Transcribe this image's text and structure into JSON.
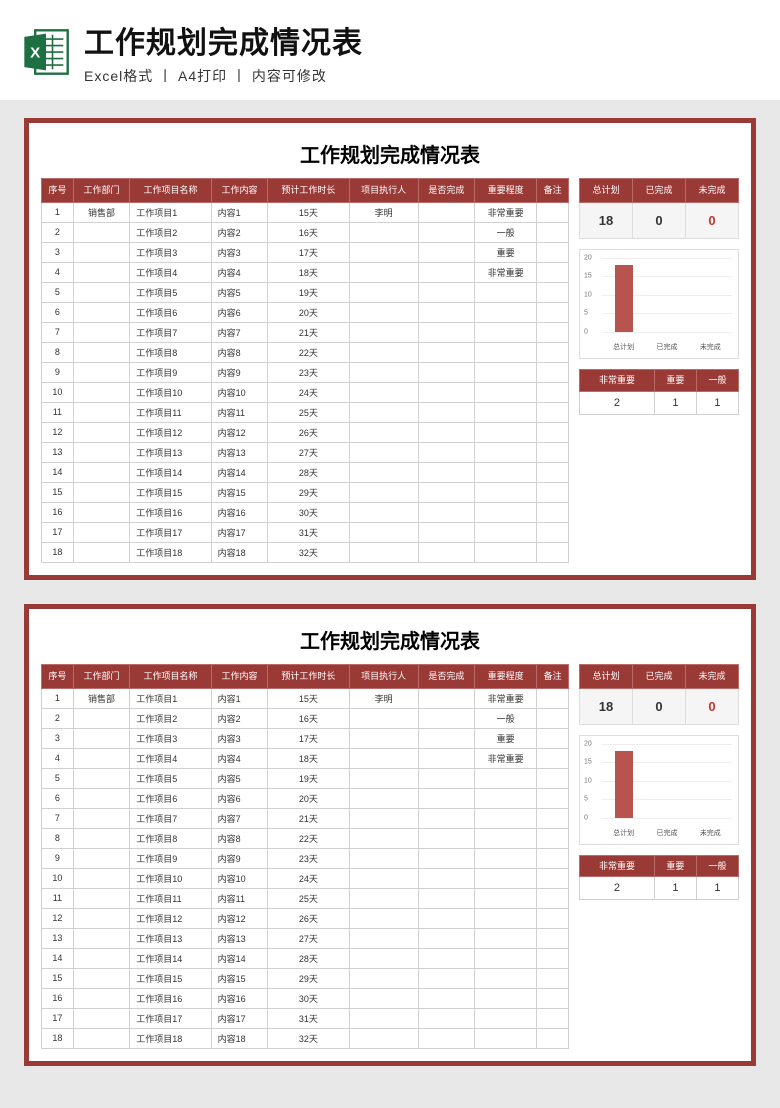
{
  "header": {
    "title": "工作规划完成情况表",
    "subtitle": "Excel格式 丨 A4打印 丨 内容可修改"
  },
  "sheet": {
    "title": "工作规划完成情况表",
    "columns": [
      "序号",
      "工作部门",
      "工作项目名称",
      "工作内容",
      "预计工作时长",
      "项目执行人",
      "是否完成",
      "重要程度",
      "备注"
    ],
    "rows": [
      {
        "no": "1",
        "dept": "销售部",
        "proj": "工作项目1",
        "content": "内容1",
        "dur": "15天",
        "exec": "李明",
        "done": "",
        "priority": "非常重要",
        "note": ""
      },
      {
        "no": "2",
        "dept": "",
        "proj": "工作项目2",
        "content": "内容2",
        "dur": "16天",
        "exec": "",
        "done": "",
        "priority": "一般",
        "note": ""
      },
      {
        "no": "3",
        "dept": "",
        "proj": "工作项目3",
        "content": "内容3",
        "dur": "17天",
        "exec": "",
        "done": "",
        "priority": "重要",
        "note": ""
      },
      {
        "no": "4",
        "dept": "",
        "proj": "工作项目4",
        "content": "内容4",
        "dur": "18天",
        "exec": "",
        "done": "",
        "priority": "非常重要",
        "note": ""
      },
      {
        "no": "5",
        "dept": "",
        "proj": "工作项目5",
        "content": "内容5",
        "dur": "19天",
        "exec": "",
        "done": "",
        "priority": "",
        "note": ""
      },
      {
        "no": "6",
        "dept": "",
        "proj": "工作项目6",
        "content": "内容6",
        "dur": "20天",
        "exec": "",
        "done": "",
        "priority": "",
        "note": ""
      },
      {
        "no": "7",
        "dept": "",
        "proj": "工作项目7",
        "content": "内容7",
        "dur": "21天",
        "exec": "",
        "done": "",
        "priority": "",
        "note": ""
      },
      {
        "no": "8",
        "dept": "",
        "proj": "工作项目8",
        "content": "内容8",
        "dur": "22天",
        "exec": "",
        "done": "",
        "priority": "",
        "note": ""
      },
      {
        "no": "9",
        "dept": "",
        "proj": "工作项目9",
        "content": "内容9",
        "dur": "23天",
        "exec": "",
        "done": "",
        "priority": "",
        "note": ""
      },
      {
        "no": "10",
        "dept": "",
        "proj": "工作项目10",
        "content": "内容10",
        "dur": "24天",
        "exec": "",
        "done": "",
        "priority": "",
        "note": ""
      },
      {
        "no": "11",
        "dept": "",
        "proj": "工作项目11",
        "content": "内容11",
        "dur": "25天",
        "exec": "",
        "done": "",
        "priority": "",
        "note": ""
      },
      {
        "no": "12",
        "dept": "",
        "proj": "工作项目12",
        "content": "内容12",
        "dur": "26天",
        "exec": "",
        "done": "",
        "priority": "",
        "note": ""
      },
      {
        "no": "13",
        "dept": "",
        "proj": "工作项目13",
        "content": "内容13",
        "dur": "27天",
        "exec": "",
        "done": "",
        "priority": "",
        "note": ""
      },
      {
        "no": "14",
        "dept": "",
        "proj": "工作项目14",
        "content": "内容14",
        "dur": "28天",
        "exec": "",
        "done": "",
        "priority": "",
        "note": ""
      },
      {
        "no": "15",
        "dept": "",
        "proj": "工作项目15",
        "content": "内容15",
        "dur": "29天",
        "exec": "",
        "done": "",
        "priority": "",
        "note": ""
      },
      {
        "no": "16",
        "dept": "",
        "proj": "工作项目16",
        "content": "内容16",
        "dur": "30天",
        "exec": "",
        "done": "",
        "priority": "",
        "note": ""
      },
      {
        "no": "17",
        "dept": "",
        "proj": "工作项目17",
        "content": "内容17",
        "dur": "31天",
        "exec": "",
        "done": "",
        "priority": "",
        "note": ""
      },
      {
        "no": "18",
        "dept": "",
        "proj": "工作项目18",
        "content": "内容18",
        "dur": "32天",
        "exec": "",
        "done": "",
        "priority": "",
        "note": ""
      }
    ],
    "summary": {
      "headers": [
        "总计划",
        "已完成",
        "未完成"
      ],
      "values": [
        "18",
        "0",
        "0"
      ]
    },
    "priority": {
      "headers": [
        "非常重要",
        "重要",
        "一般"
      ],
      "values": [
        "2",
        "1",
        "1"
      ]
    }
  },
  "chart_data": {
    "type": "bar",
    "categories": [
      "总计划",
      "已完成",
      "未完成"
    ],
    "values": [
      18,
      0,
      0
    ],
    "ylim": [
      0,
      20
    ],
    "yticks": [
      0,
      5,
      10,
      15,
      20
    ],
    "title": "",
    "xlabel": "",
    "ylabel": ""
  }
}
